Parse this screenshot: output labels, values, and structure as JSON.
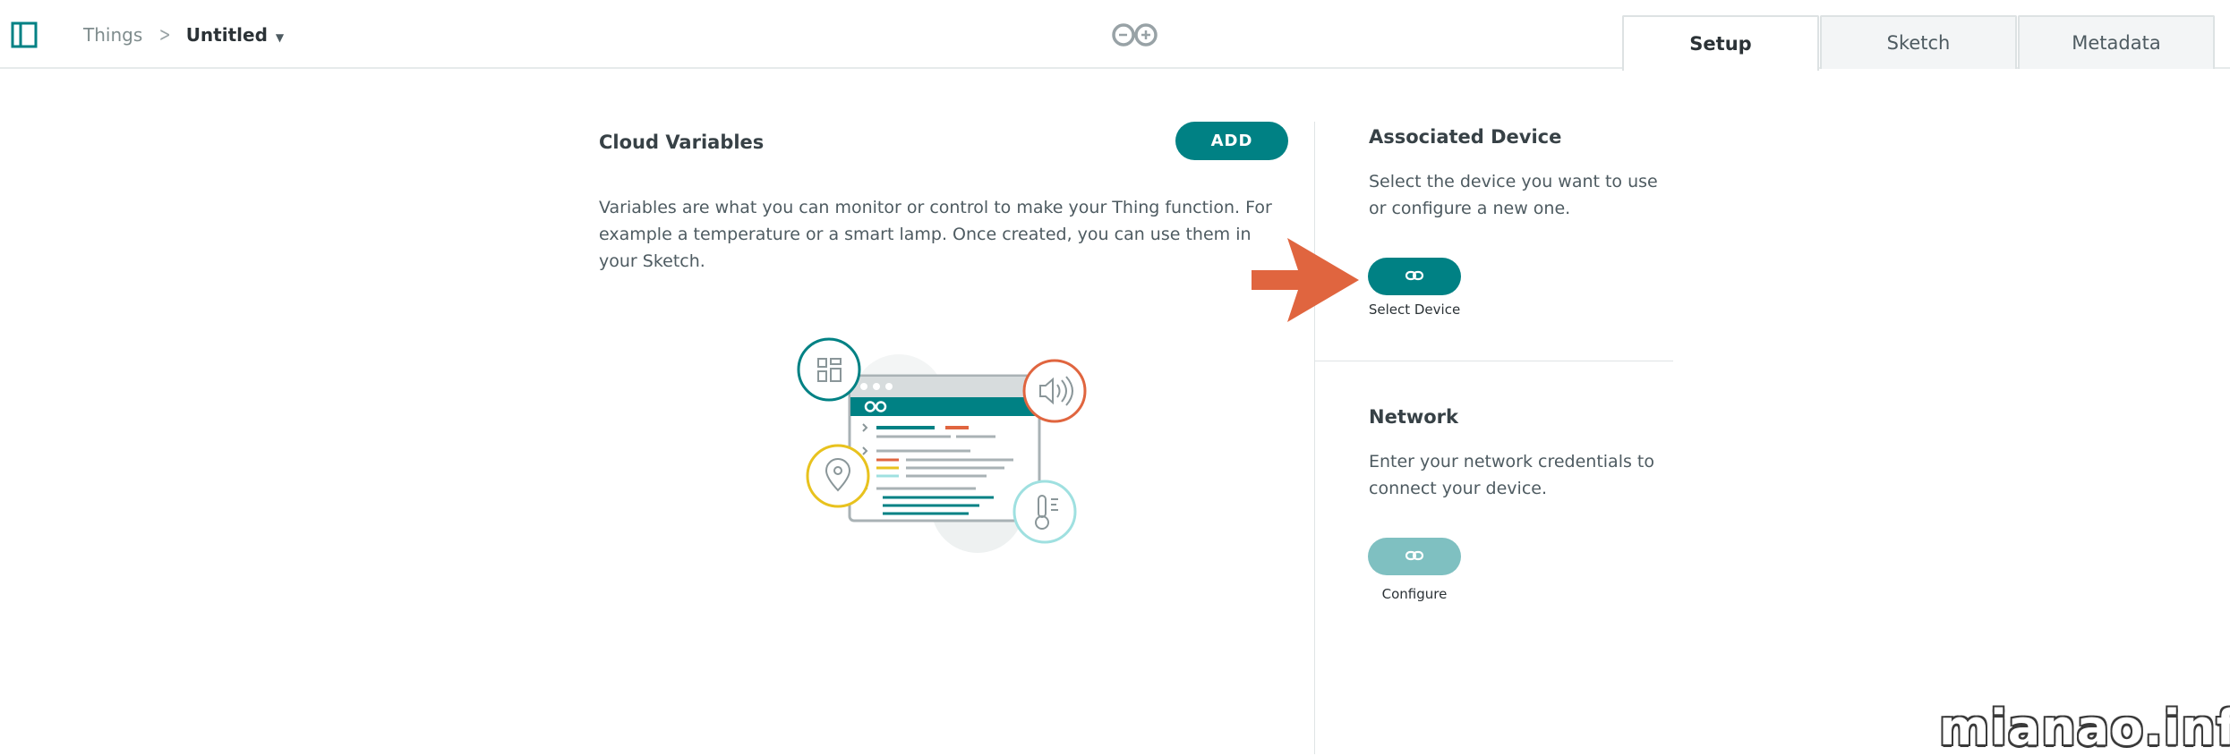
{
  "breadcrumb": {
    "root": "Things",
    "current": "Untitled"
  },
  "tabs": [
    {
      "label": "Setup",
      "active": true
    },
    {
      "label": "Sketch",
      "active": false
    },
    {
      "label": "Metadata",
      "active": false
    }
  ],
  "cloud_variables": {
    "title": "Cloud Variables",
    "add_label": "ADD",
    "description": "Variables are what you can monitor or control to make your Thing function. For example a temperature or a smart lamp. Once created, you can use them in your Sketch."
  },
  "associated_device": {
    "title": "Associated Device",
    "description": "Select the device you want to use or configure a new one.",
    "button_label": "Select Device"
  },
  "network": {
    "title": "Network",
    "description": "Enter your network credentials to connect your device.",
    "button_label": "Configure"
  },
  "watermark": "mianao.info",
  "colors": {
    "primary": "#008184",
    "primary_disabled": "#7fc0c1",
    "arrow": "#e0653f",
    "accent_orange": "#e0653f",
    "accent_yellow": "#e8c21e",
    "accent_light_teal": "#9fe0e0"
  },
  "icons": {
    "sidebar_toggle": "sidebar-toggle-icon",
    "brand": "arduino-infinity-logo",
    "link": "link-icon"
  }
}
